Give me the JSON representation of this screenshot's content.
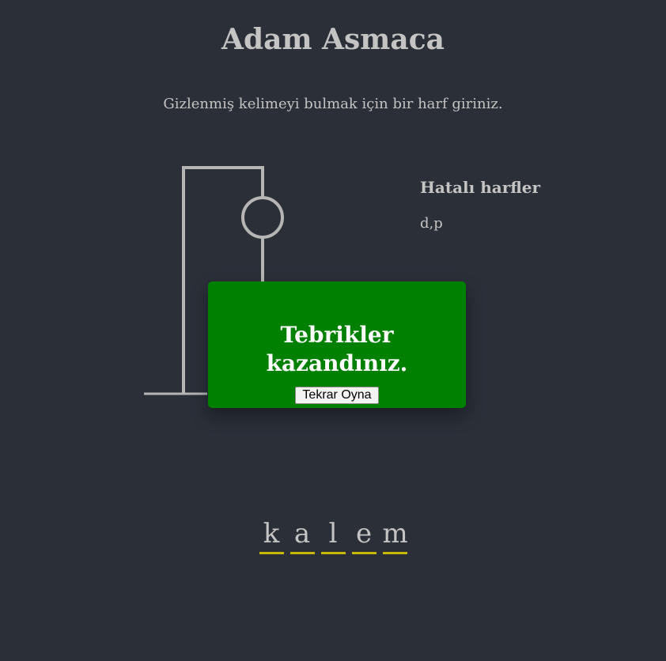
{
  "title": "Adam Asmaca",
  "instruction": "Gizlenmiş kelimeyi bulmak için bir harf giriniz.",
  "wrong": {
    "title": "Hatalı harfler",
    "letters": "d,p"
  },
  "popup": {
    "message": "Tebrikler kazandınız.",
    "button_label": "Tekrar Oyna"
  },
  "word": {
    "letters": [
      "k",
      "a",
      "l",
      "e",
      "m"
    ]
  },
  "colors": {
    "background": "#2a2f38",
    "text": "#c4c4c4",
    "popup": "#008000",
    "underline": "#c8b800"
  }
}
